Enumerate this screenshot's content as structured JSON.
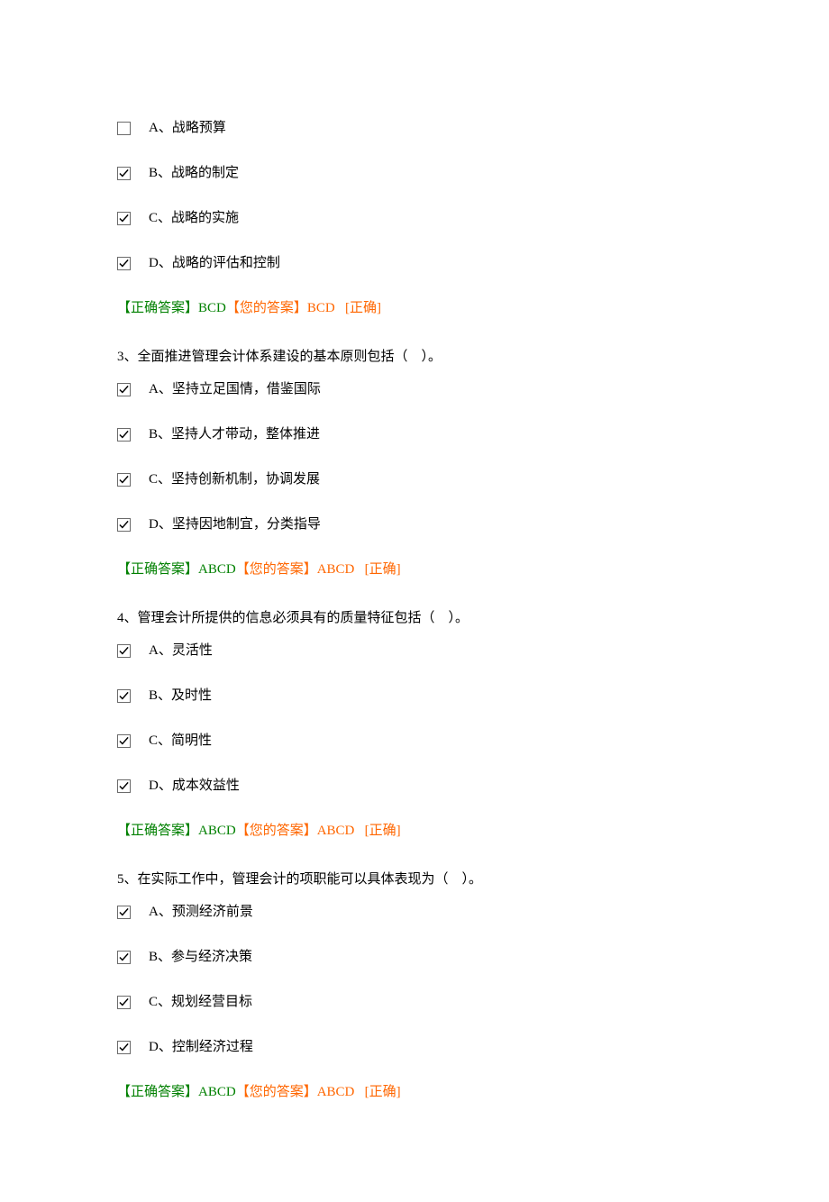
{
  "answerLabels": {
    "correctLabel": "【正确答案】",
    "yourLabel": "【您的答案】",
    "statusCorrect": "[正确]"
  },
  "questions": [
    {
      "stem": "",
      "options": [
        {
          "letter": "A",
          "text": "战略预算",
          "checked": false
        },
        {
          "letter": "B",
          "text": "战略的制定",
          "checked": true
        },
        {
          "letter": "C",
          "text": "战略的实施",
          "checked": true
        },
        {
          "letter": "D",
          "text": "战略的评估和控制",
          "checked": true
        }
      ],
      "correctAnswer": "BCD",
      "yourAnswer": "BCD"
    },
    {
      "stem": "3、全面推进管理会计体系建设的基本原则包括（　）。",
      "options": [
        {
          "letter": "A",
          "text": "坚持立足国情，借鉴国际",
          "checked": true
        },
        {
          "letter": "B",
          "text": "坚持人才带动，整体推进",
          "checked": true
        },
        {
          "letter": "C",
          "text": "坚持创新机制，协调发展",
          "checked": true
        },
        {
          "letter": "D",
          "text": "坚持因地制宜，分类指导",
          "checked": true
        }
      ],
      "correctAnswer": "ABCD",
      "yourAnswer": "ABCD"
    },
    {
      "stem": "4、管理会计所提供的信息必须具有的质量特征包括（　）。",
      "options": [
        {
          "letter": "A",
          "text": "灵活性",
          "checked": true
        },
        {
          "letter": "B",
          "text": "及时性",
          "checked": true
        },
        {
          "letter": "C",
          "text": "简明性",
          "checked": true
        },
        {
          "letter": "D",
          "text": "成本效益性",
          "checked": true
        }
      ],
      "correctAnswer": "ABCD",
      "yourAnswer": "ABCD"
    },
    {
      "stem": "5、在实际工作中，管理会计的项职能可以具体表现为（　）。",
      "options": [
        {
          "letter": "A",
          "text": "预测经济前景",
          "checked": true
        },
        {
          "letter": "B",
          "text": "参与经济决策",
          "checked": true
        },
        {
          "letter": "C",
          "text": "规划经营目标",
          "checked": true
        },
        {
          "letter": "D",
          "text": "控制经济过程",
          "checked": true
        }
      ],
      "correctAnswer": "ABCD",
      "yourAnswer": "ABCD"
    }
  ]
}
